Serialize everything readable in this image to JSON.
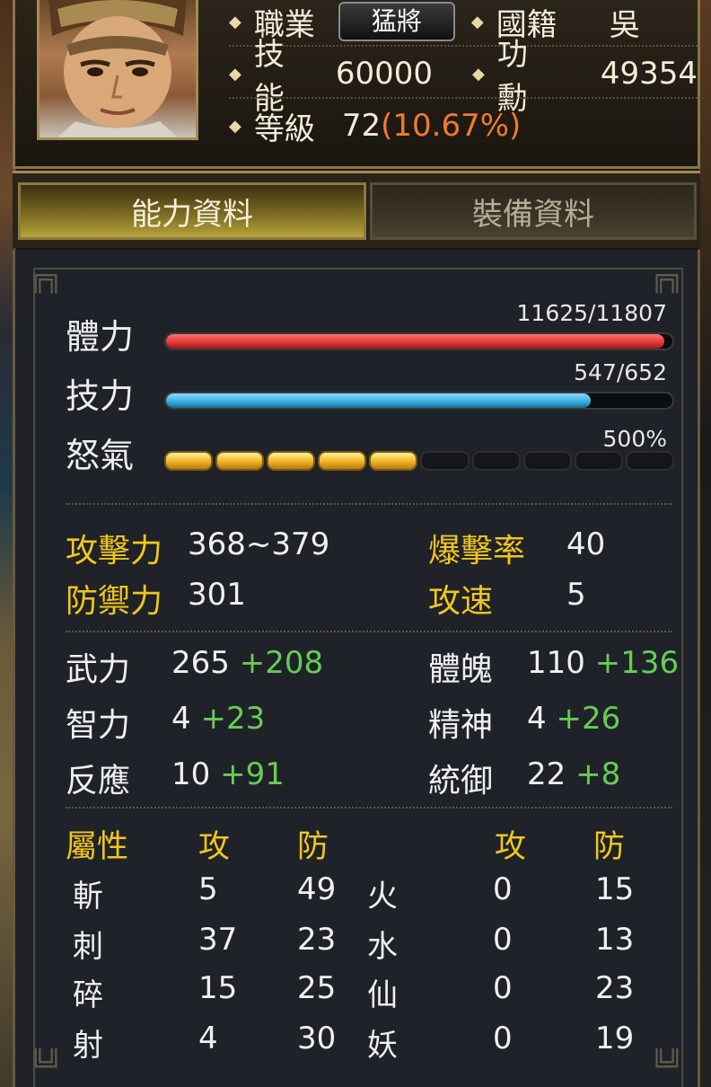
{
  "header": {
    "job_label": "職業",
    "job_value": "猛將",
    "nation_label": "國籍",
    "nation_value": "吳",
    "skill_label": "技能",
    "skill_value": "60000",
    "merit_label": "功勳",
    "merit_value": "49354",
    "level_label": "等級",
    "level_value": "72",
    "level_percent": "(10.67%)"
  },
  "tabs": {
    "ability": "能力資料",
    "equipment": "裝備資料"
  },
  "vitals": {
    "hp_label": "體力",
    "hp_value": "11625/11807",
    "hp_current": 11625,
    "hp_max": 11807,
    "mp_label": "技力",
    "mp_value": "547/652",
    "mp_current": 547,
    "mp_max": 652,
    "rage_label": "怒氣",
    "rage_value": "500%",
    "rage_segments_total": 10,
    "rage_segments_filled": 5
  },
  "combat": {
    "attack_label": "攻擊力",
    "attack_value": "368~379",
    "crit_label": "爆擊率",
    "crit_value": "40",
    "defense_label": "防禦力",
    "defense_value": "301",
    "speed_label": "攻速",
    "speed_value": "5"
  },
  "attributes": {
    "str_label": "武力",
    "str_value": "265",
    "str_bonus": "+208",
    "con_label": "體魄",
    "con_value": "110",
    "con_bonus": "+136",
    "int_label": "智力",
    "int_value": "4",
    "int_bonus": "+23",
    "spi_label": "精神",
    "spi_value": "4",
    "spi_bonus": "+26",
    "ref_label": "反應",
    "ref_value": "10",
    "ref_bonus": "+91",
    "cmd_label": "統御",
    "cmd_value": "22",
    "cmd_bonus": "+8"
  },
  "elements": {
    "header_label": "屬性",
    "atk_header": "攻",
    "def_header": "防",
    "atk_header2": "攻",
    "def_header2": "防",
    "left": [
      {
        "name": "斬",
        "atk": "5",
        "def": "49"
      },
      {
        "name": "刺",
        "atk": "37",
        "def": "23"
      },
      {
        "name": "碎",
        "atk": "15",
        "def": "25"
      },
      {
        "name": "射",
        "atk": "4",
        "def": "30"
      }
    ],
    "right": [
      {
        "name": "火",
        "atk": "0",
        "def": "15"
      },
      {
        "name": "水",
        "atk": "0",
        "def": "13"
      },
      {
        "name": "仙",
        "atk": "0",
        "def": "23"
      },
      {
        "name": "妖",
        "atk": "0",
        "def": "19"
      }
    ]
  },
  "colors": {
    "hp_bar": "#e23a3a",
    "mp_bar": "#3ab0e0",
    "gold_label": "#f0c61c",
    "bonus_green": "#66cc55",
    "level_percent": "#f07a30"
  }
}
